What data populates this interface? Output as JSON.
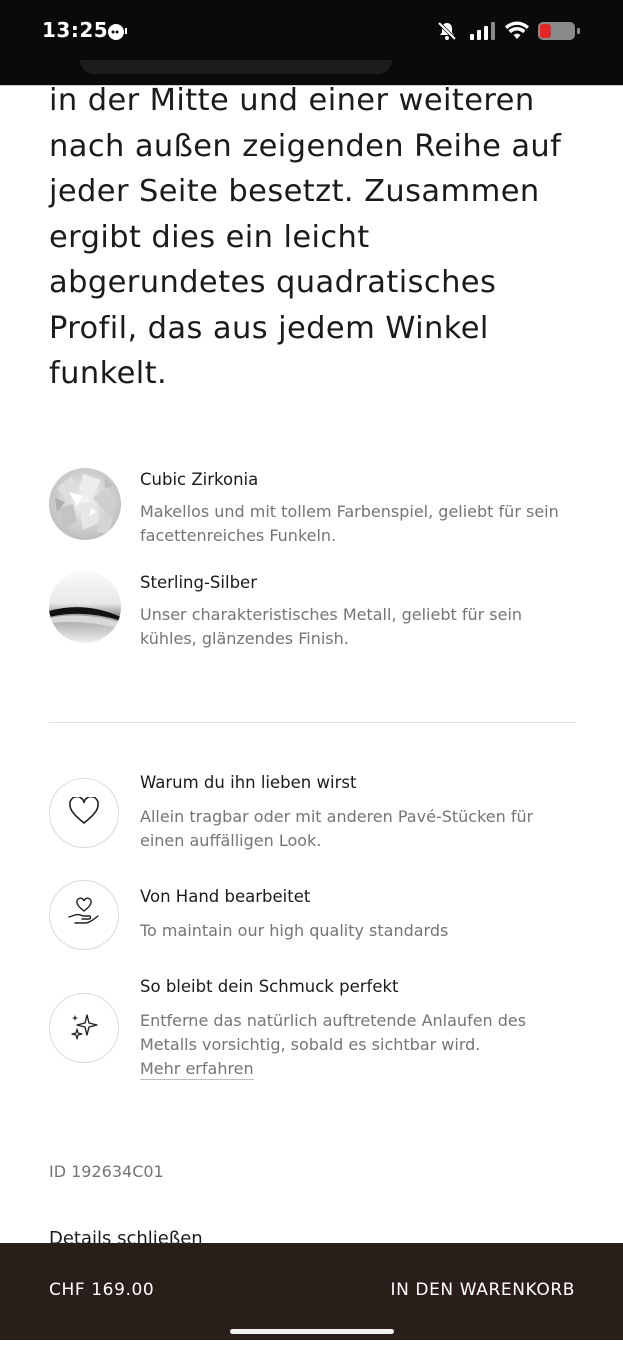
{
  "status_bar": {
    "time": "13:25"
  },
  "lead_text": "in der Mitte und einer weiteren nach außen zeigenden Reihe auf jeder Seite besetzt. Zusammen ergibt dies ein leicht abgerundetes quadratisches Profil, das aus jedem Winkel funkelt.",
  "materials": [
    {
      "title": "Cubic Zirkonia",
      "description": "Makellos und mit tollem Farbenspiel, geliebt für sein facettenreiches Funkeln."
    },
    {
      "title": "Sterling-Silber",
      "description": "Unser charakteristisches Metall, geliebt für sein kühles, glänzendes Finish."
    }
  ],
  "features": [
    {
      "icon": "heart-icon",
      "title": "Warum du ihn lieben wirst",
      "description": "Allein tragbar oder mit anderen Pavé-Stücken für einen auffälligen Look."
    },
    {
      "icon": "hand-heart-icon",
      "title": "Von Hand bearbeitet",
      "description": "To maintain our high quality standards"
    },
    {
      "icon": "sparkle-icon",
      "title": "So bleibt dein Schmuck perfekt",
      "description": "Entferne das natürlich auftretende Anlaufen des Metalls vorsichtig, sobald es sichtbar wird.",
      "link": "Mehr erfahren"
    }
  ],
  "product_id": "ID 192634C01",
  "details_toggle": "Details schließen",
  "bottom_bar": {
    "price": "CHF 169.00",
    "cart_label": "IN DEN WARENKORB"
  }
}
